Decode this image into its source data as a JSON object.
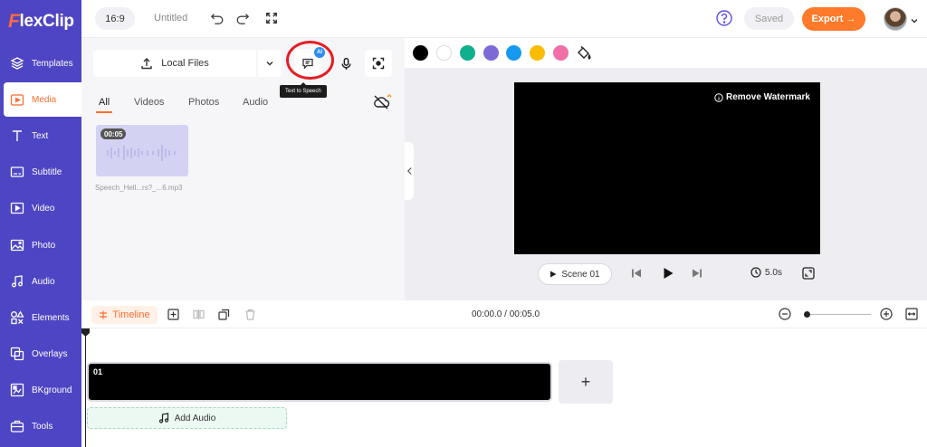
{
  "app": {
    "brand_initial": "F",
    "brand_rest": "lexClip"
  },
  "sidebar": {
    "items": [
      {
        "label": "Templates",
        "icon": "layers-icon"
      },
      {
        "label": "Media",
        "icon": "media-folder-icon",
        "active": true
      },
      {
        "label": "Text",
        "icon": "text-icon"
      },
      {
        "label": "Subtitle",
        "icon": "subtitle-icon"
      },
      {
        "label": "Video",
        "icon": "video-icon"
      },
      {
        "label": "Photo",
        "icon": "photo-icon"
      },
      {
        "label": "Audio",
        "icon": "audio-icon"
      },
      {
        "label": "Elements",
        "icon": "elements-icon"
      },
      {
        "label": "Overlays",
        "icon": "overlays-icon"
      },
      {
        "label": "BKground",
        "icon": "background-icon"
      },
      {
        "label": "Tools",
        "icon": "tools-icon"
      }
    ]
  },
  "topbar": {
    "ratio": "16:9",
    "project_name": "Untitled",
    "saved_label": "Saved",
    "export_label": "Export →"
  },
  "media_panel": {
    "local_files_label": "Local Files",
    "tts_tooltip": "Text to Speech",
    "ai_badge": "AI",
    "tabs": [
      "All",
      "Videos",
      "Photos",
      "Audio"
    ],
    "active_tab": "All",
    "clips": [
      {
        "duration": "00:05",
        "filename": "Speech_Hell...rs?_...6.mp3"
      }
    ]
  },
  "color_bar": {
    "swatches": [
      "#000000",
      "#ffffff",
      "#0fb08d",
      "#7e6ad6",
      "#1599f0",
      "#fbbc05",
      "#f16fa8"
    ]
  },
  "preview": {
    "watermark_label": "Remove Watermark",
    "scene_label": "Scene 01",
    "duration": "5.0s"
  },
  "timeline": {
    "label": "Timeline",
    "time_readout": "00:00.0 / 00:05.0",
    "scene_number": "01",
    "add_scene_label": "+",
    "add_audio_label": "Add Audio"
  }
}
